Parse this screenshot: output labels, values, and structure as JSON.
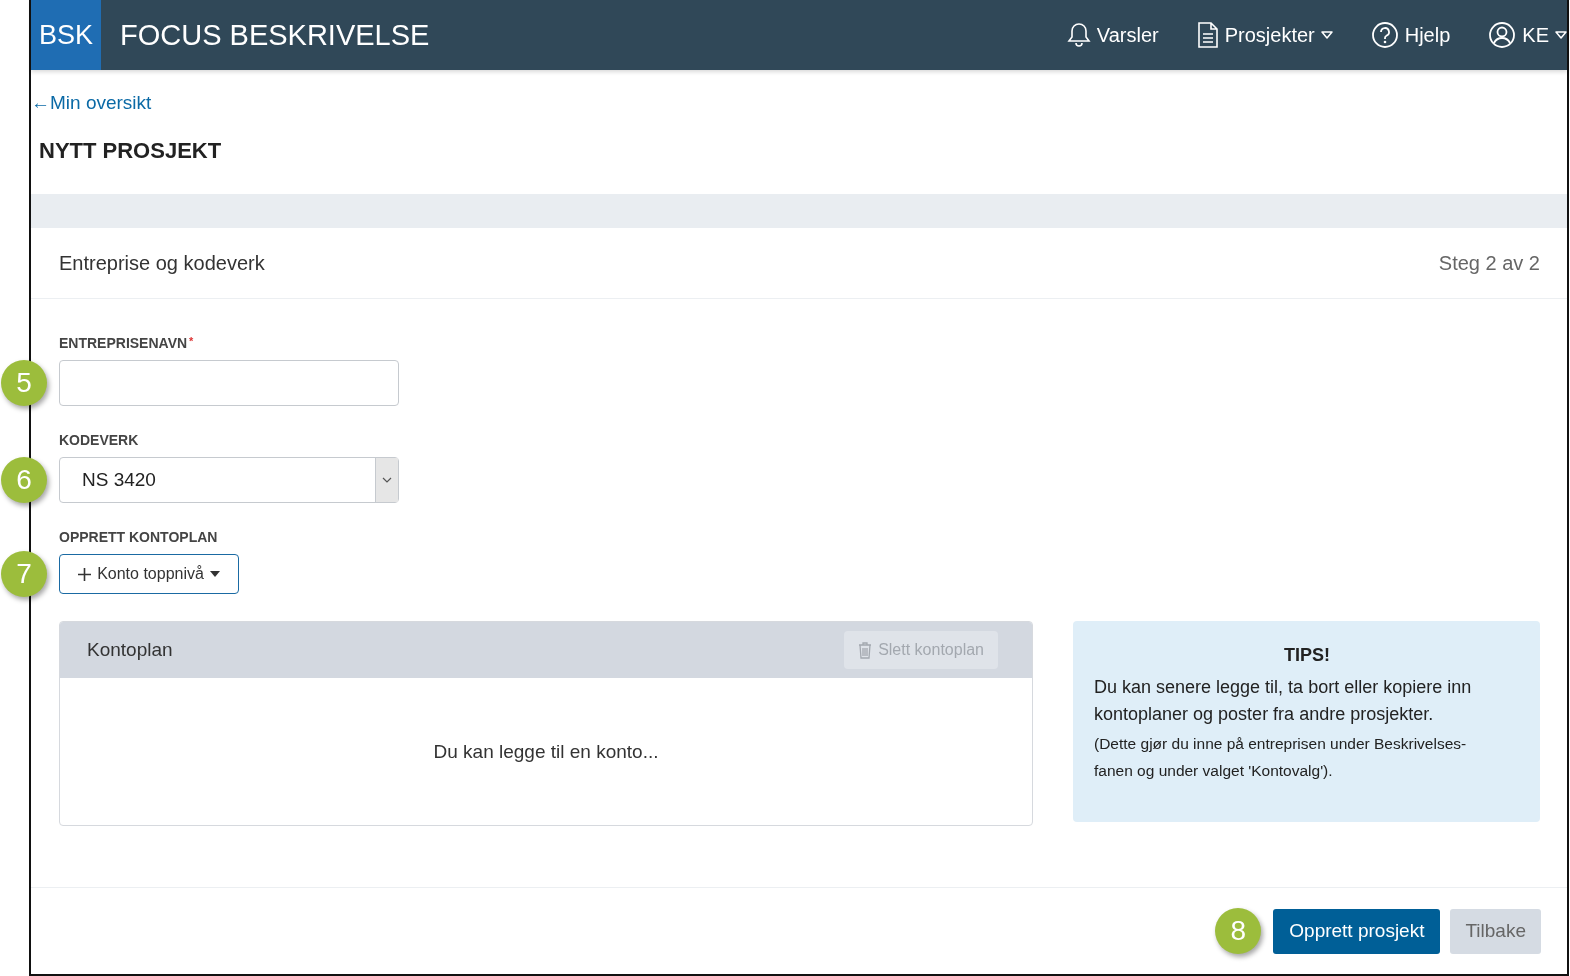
{
  "header": {
    "logo": "BSK",
    "title": "FOCUS BESKRIVELSE",
    "nav": [
      {
        "label": "Varsler",
        "kind": "bell",
        "dropdown": false
      },
      {
        "label": "Prosjekter",
        "kind": "document",
        "dropdown": true
      },
      {
        "label": "Hjelp",
        "kind": "help",
        "dropdown": false
      },
      {
        "label": "KE",
        "kind": "user",
        "dropdown": true
      }
    ]
  },
  "back_link": "←Min oversikt",
  "page_title": "NYTT PROSJEKT",
  "card": {
    "title": "Entreprise og kodeverk",
    "step": "Steg 2 av 2"
  },
  "fields": [
    {
      "kind": "text",
      "label": "ENTREPRISENAVN",
      "required_mark": "*",
      "callout": "5"
    },
    {
      "kind": "select",
      "label": "KODEVERK",
      "value": "NS 3420",
      "callout": "6"
    },
    {
      "kind": "dropdown_button",
      "label": "OPPRETT KONTOPLAN",
      "button": "Konto toppnivå",
      "callout": "7"
    }
  ],
  "kontoplan": {
    "title": "Kontoplan",
    "delete_button": {
      "label": "Slett kontoplan",
      "disabled": true
    },
    "empty_text": "Du kan legge til en konto..."
  },
  "tips": {
    "title": "TIPS!",
    "text": "Du kan senere legge til, ta bort eller kopiere inn kontoplaner og poster fra andre prosjekter.",
    "note": "(Dette gjør du inne på entreprisen under Beskrivelses-fanen og under valget 'Kontovalg')."
  },
  "footer": {
    "callout": "8",
    "buttons": [
      {
        "label": "Opprett prosjekt",
        "kind": "primary"
      },
      {
        "label": "Tilbake",
        "kind": "secondary"
      }
    ]
  }
}
